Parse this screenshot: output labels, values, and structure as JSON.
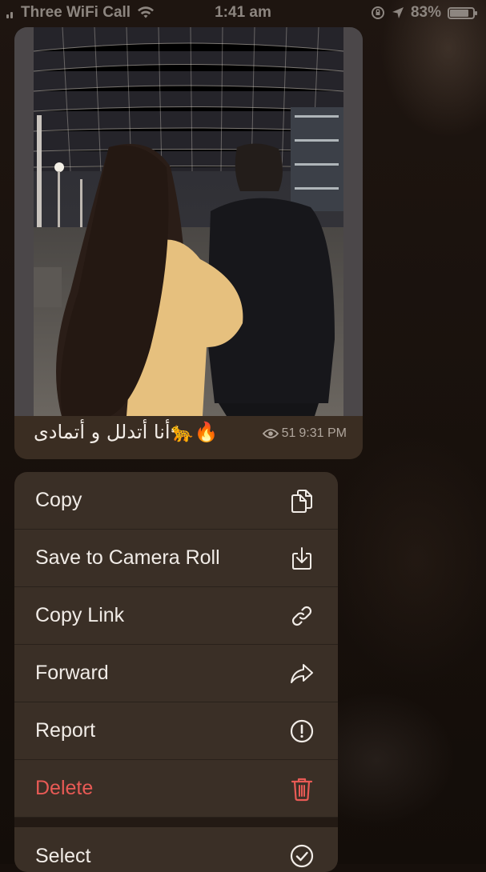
{
  "status_bar": {
    "carrier": "Three WiFi Call",
    "time": "1:41 am",
    "battery": "83%",
    "battery_level": 0.83
  },
  "message": {
    "caption": "🔥🐆أنا أتدلل و أتمادى",
    "views": "51",
    "time": "9:31 PM"
  },
  "menu": {
    "items": [
      {
        "label": "Copy",
        "icon": "copy-icon"
      },
      {
        "label": "Save to Camera Roll",
        "icon": "download-icon"
      },
      {
        "label": "Copy Link",
        "icon": "link-icon"
      },
      {
        "label": "Forward",
        "icon": "forward-icon"
      },
      {
        "label": "Report",
        "icon": "report-icon"
      },
      {
        "label": "Delete",
        "icon": "trash-icon"
      },
      {
        "label": "Select",
        "icon": "checkmark-circle-icon"
      }
    ]
  },
  "colors": {
    "accent_danger": "#e85a55",
    "menu_bg": "#3a2f26",
    "text": "#f1ece7"
  }
}
